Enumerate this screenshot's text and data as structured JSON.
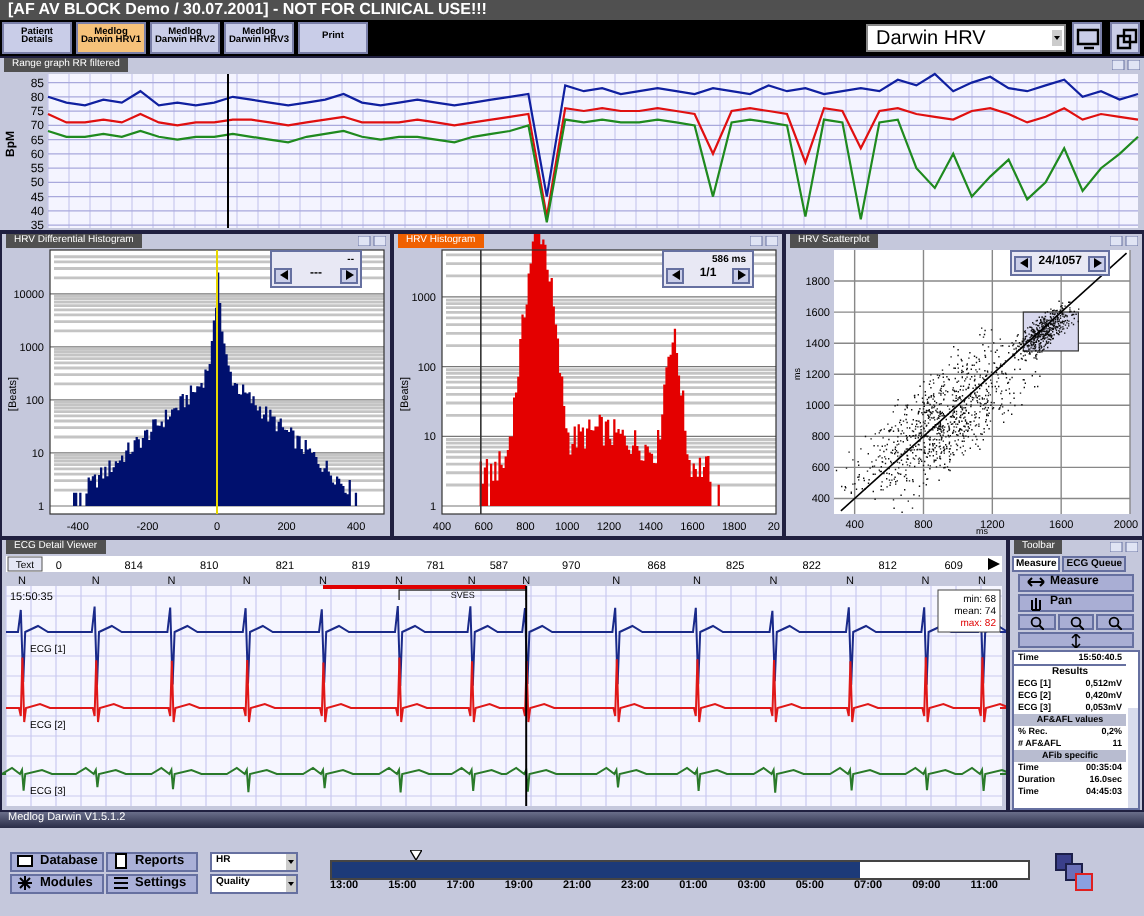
{
  "window": {
    "title": "[AF AV BLOCK Demo / 30.07.2001] - NOT FOR CLINICAL USE!!!"
  },
  "tabs": [
    {
      "label": "Patient Details",
      "selected": false
    },
    {
      "label": "Medlog Darwin HRV1",
      "selected": true
    },
    {
      "label": "Medlog Darwin HRV2",
      "selected": false
    },
    {
      "label": "Medlog Darwin HRV3",
      "selected": false
    },
    {
      "label": "Print",
      "selected": false
    }
  ],
  "module_select": {
    "value": "Darwin HRV"
  },
  "trend": {
    "chart_data": {
      "type": "line",
      "title": "Range graph RR filtered",
      "ylabel": "BpM",
      "ylim": [
        34,
        88
      ],
      "grid": true,
      "yticks": [
        85,
        80,
        75,
        70,
        65,
        60,
        55,
        50,
        45,
        40,
        35
      ],
      "series": [
        {
          "color": "#1020a0",
          "values": [
            80,
            78,
            77,
            79,
            78,
            82,
            77,
            78,
            77,
            78,
            80,
            79,
            78,
            77,
            78,
            79,
            81,
            78,
            77,
            78,
            79,
            78,
            77,
            78,
            79,
            80,
            81,
            45,
            84,
            82,
            83,
            81,
            82,
            83,
            82,
            81,
            83,
            82,
            81,
            84,
            82,
            83,
            81,
            82,
            83,
            82,
            86,
            84,
            88,
            82,
            85,
            87,
            83,
            82,
            84,
            86,
            80,
            82,
            79,
            81
          ]
        },
        {
          "color": "#e01010",
          "values": [
            74,
            71,
            71,
            72,
            71,
            74,
            71,
            70,
            71,
            71,
            72,
            72,
            71,
            70,
            71,
            72,
            73,
            71,
            71,
            71,
            72,
            71,
            70,
            71,
            72,
            73,
            74,
            38,
            76,
            75,
            76,
            75,
            75,
            76,
            75,
            74,
            60,
            75,
            76,
            75,
            74,
            57,
            76,
            75,
            62,
            75,
            76,
            74,
            73,
            72,
            75,
            76,
            74,
            71,
            73,
            76,
            72,
            74,
            73,
            72
          ]
        },
        {
          "color": "#1f8a1f",
          "values": [
            68,
            66,
            66,
            67,
            66,
            68,
            66,
            65,
            66,
            66,
            67,
            66,
            65,
            64,
            66,
            67,
            68,
            66,
            65,
            66,
            66,
            65,
            64,
            66,
            67,
            68,
            70,
            36,
            72,
            71,
            72,
            71,
            71,
            72,
            71,
            70,
            45,
            71,
            72,
            71,
            70,
            38,
            72,
            71,
            37,
            71,
            72,
            55,
            48,
            60,
            45,
            52,
            58,
            44,
            50,
            62,
            47,
            55,
            60,
            66
          ]
        }
      ]
    }
  },
  "diff_histogram": {
    "title": "HRV Differential Histogram",
    "navigator_top": "--",
    "navigator": "---",
    "y_label": "[Beats]",
    "y_ticks": [
      "10000",
      "1000",
      "100",
      "10",
      "1"
    ],
    "x_ticks": [
      "-400",
      "-200",
      "0",
      "200",
      "400"
    ]
  },
  "histogram": {
    "title": "HRV Histogram",
    "navigator_top": "586 ms",
    "navigator": "1/1",
    "y_label": "[Beats]",
    "y_ticks": [
      "1000",
      "100",
      "10",
      "1"
    ],
    "x_ticks": [
      "400",
      "600",
      "800",
      "1000",
      "1200",
      "1400",
      "1600",
      "1800",
      "20"
    ]
  },
  "scatterplot": {
    "title": "HRV Scatterplot",
    "navigator": "24/1057",
    "y_label": "ms",
    "x_label": "ms",
    "y_ticks": [
      "1800",
      "1600",
      "1400",
      "1200",
      "1000",
      "800",
      "600",
      "400"
    ],
    "x_ticks": [
      "400",
      "800",
      "1200",
      "1600",
      "2000"
    ]
  },
  "ecg": {
    "title": "ECG Detail Viewer",
    "button": "Text",
    "time": "15:50:35",
    "event_label": "SVES",
    "beats": [
      "N",
      "N",
      "N",
      "N",
      "N",
      "N",
      "N",
      "N",
      "N",
      "N",
      "N",
      "N",
      "N",
      "N"
    ],
    "intervals": [
      "0",
      "814",
      "810",
      "821",
      "819",
      "781",
      "587",
      "970",
      "868",
      "825",
      "822",
      "812",
      "609"
    ],
    "stats": [
      "min: 68",
      "mean: 74",
      "max: 82"
    ],
    "channels": [
      "ECG [1]",
      "ECG [2]",
      "ECG [3]"
    ]
  },
  "side_panel": {
    "title": "Toolbar",
    "tabs": [
      {
        "label": "Measure",
        "selected": true
      },
      {
        "label": "ECG Queue",
        "selected": false
      }
    ],
    "buttons": [
      "Measure",
      "Pan"
    ],
    "sections": [
      {
        "kind": "plain",
        "rows": [
          {
            "label": "Time",
            "value": "15:50:40.5"
          }
        ]
      },
      {
        "kind": "heading",
        "title": "Results",
        "rows": [
          {
            "label": "ECG [1]",
            "value": "0,512mV"
          },
          {
            "label": "ECG [2]",
            "value": "0,420mV"
          },
          {
            "label": "ECG [3]",
            "value": "0,053mV"
          }
        ]
      },
      {
        "kind": "banner",
        "title": "AF&AFL values",
        "rows": [
          {
            "label": "% Rec.",
            "value": "0,2%"
          },
          {
            "label": "# AF&AFL",
            "value": "11"
          }
        ]
      },
      {
        "kind": "banner",
        "title": "AFib specific",
        "rows": [
          {
            "label": "Time",
            "value": "00:35:04"
          },
          {
            "label": "Duration",
            "value": "16.0sec"
          },
          {
            "label": "Time",
            "value": "04:45:03"
          }
        ]
      }
    ]
  },
  "status_title": "Medlog Darwin V1.5.1.2",
  "nav_buttons": [
    "Database",
    "Reports",
    "Modules",
    "Settings"
  ],
  "selects": [
    "HR",
    "Quality"
  ],
  "timeline": {
    "level": 0.76,
    "labels": [
      "13:00",
      "15:00",
      "17:00",
      "19:00",
      "21:00",
      "23:00",
      "01:00",
      "03:00",
      "05:00",
      "07:00",
      "09:00",
      "11:00"
    ]
  }
}
